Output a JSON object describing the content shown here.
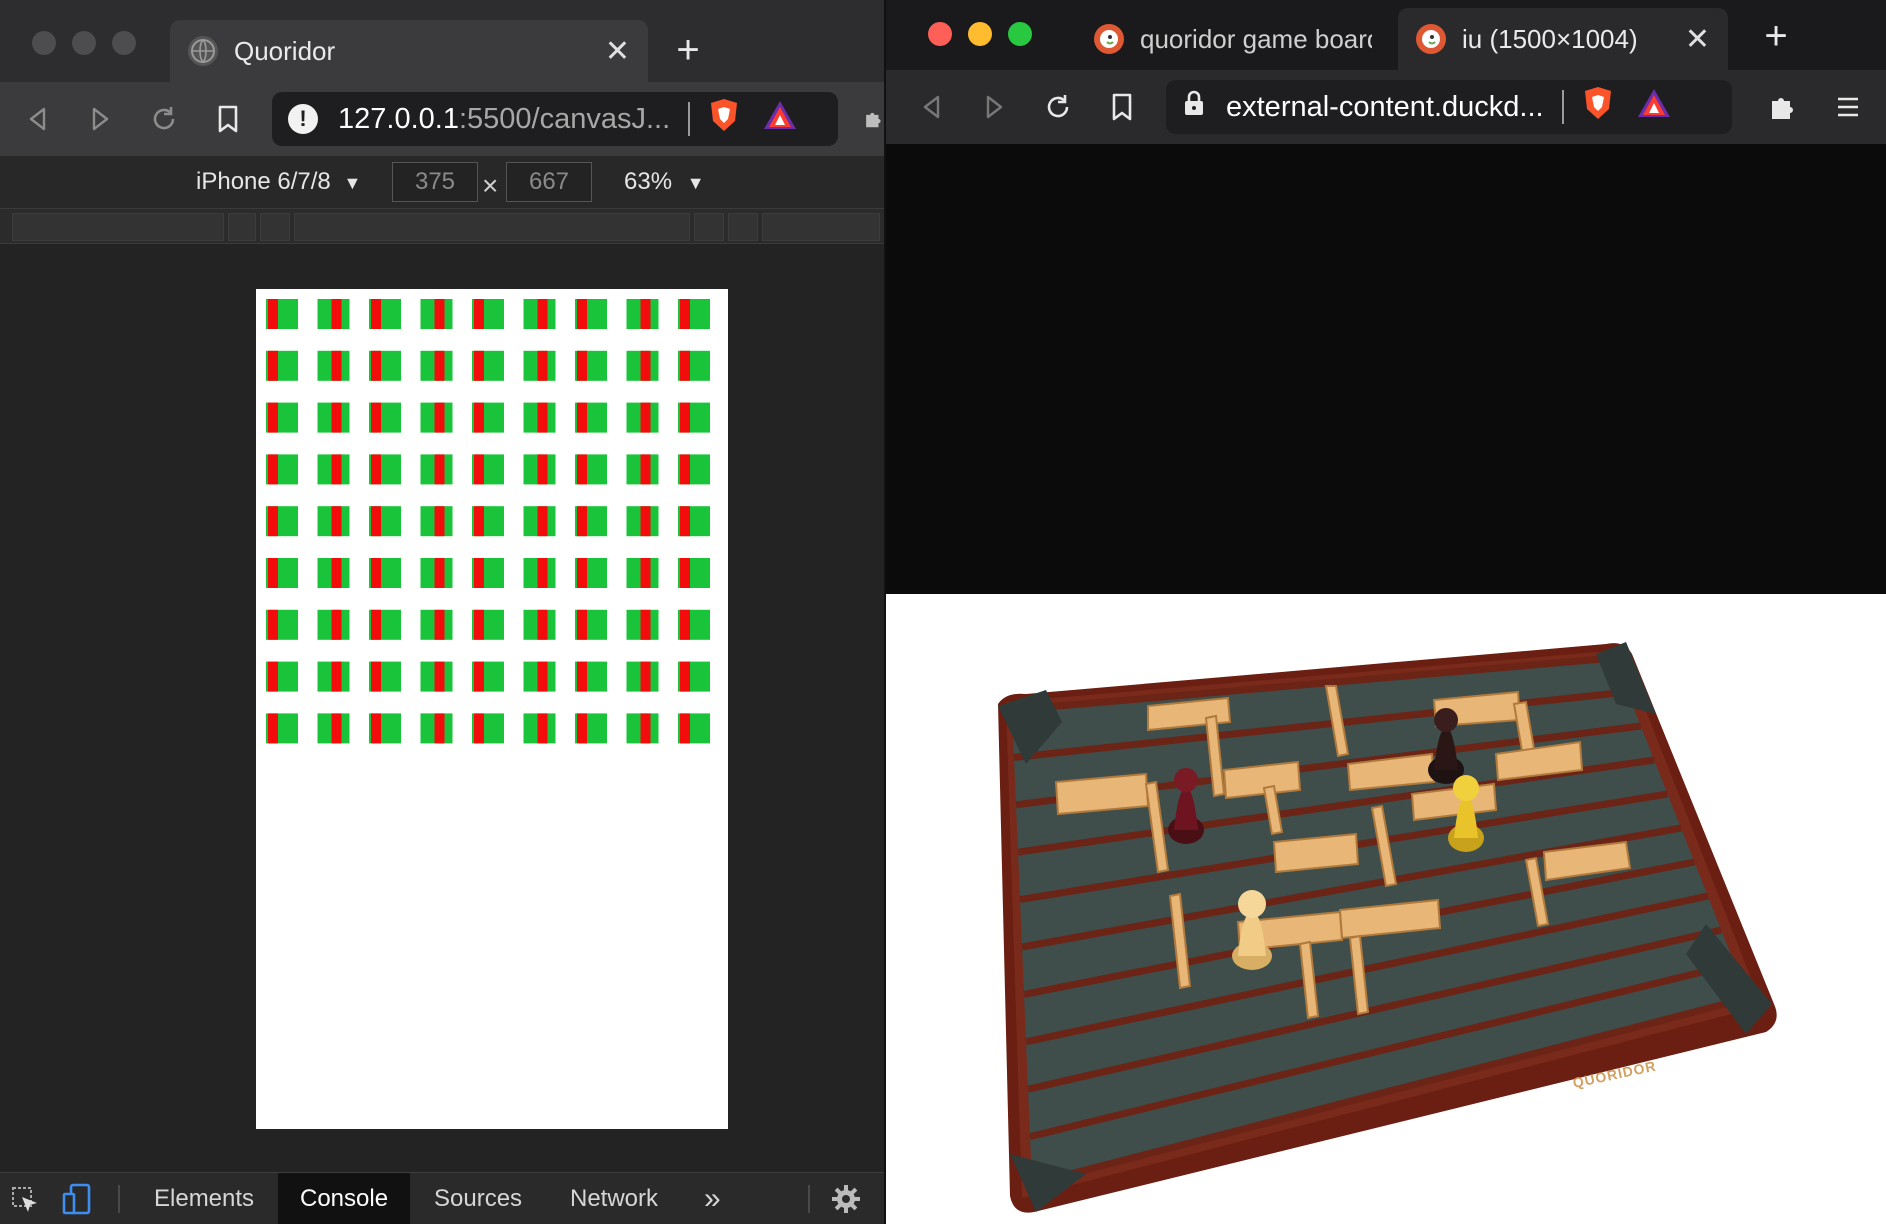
{
  "left_window": {
    "tab": {
      "title": "Quoridor",
      "close": "✕"
    },
    "new_tab": "+",
    "url": {
      "host": "127.0.0.1",
      "rest": ":5500/canvasJ..."
    },
    "device_toolbar": {
      "device": "iPhone 6/7/8",
      "width": "375",
      "times": "×",
      "height": "667",
      "zoom": "63%"
    },
    "canvas": {
      "columns": 9,
      "rows": 9,
      "green": "#19c43a",
      "red": "#f20c0c"
    },
    "devtools_tabs": [
      "Elements",
      "Console",
      "Sources",
      "Network"
    ],
    "devtools_more": "»",
    "devtools_active": "Console"
  },
  "right_window": {
    "tabs": [
      {
        "title": "quoridor game board a",
        "close": ""
      },
      {
        "title": "iu (1500×1004)",
        "close": "✕"
      }
    ],
    "new_tab": "+",
    "url": "external-content.duckd...",
    "board_text": "QUORIDOR"
  },
  "colors": {
    "traffic_red": "#fe5f57",
    "traffic_yellow": "#febc2e",
    "traffic_green": "#28c840",
    "traffic_gray": "#4d4d4f",
    "brave_orange": "#fb542b"
  }
}
